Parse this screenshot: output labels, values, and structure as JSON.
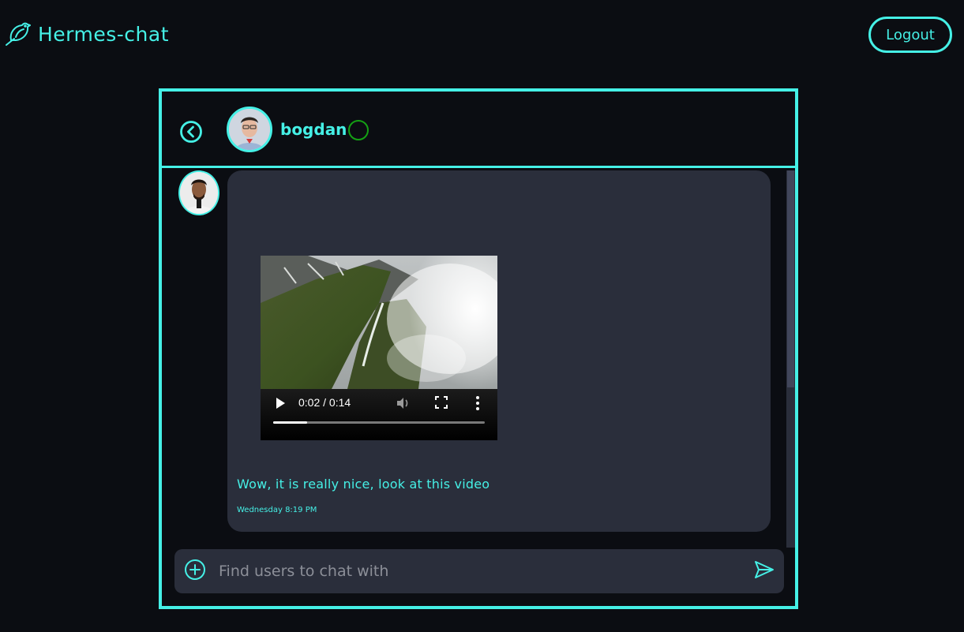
{
  "app": {
    "title": "Hermes-chat",
    "logout_label": "Logout",
    "logo_icon": "bird-icon"
  },
  "colors": {
    "accent": "#45f0e6",
    "background": "#0b0d12",
    "surface": "#2a2e3b",
    "online_status": "#14a014"
  },
  "chat": {
    "peer": {
      "name": "bogdan",
      "status": "online"
    },
    "messages": [
      {
        "media": {
          "type": "video",
          "time_display": "0:02 / 0:14",
          "progress": 0.16
        },
        "text": "Wow, it is really nice, look at this video",
        "timestamp": "Wednesday 8:19 PM"
      }
    ]
  },
  "composer": {
    "placeholder": "Find users to chat with",
    "value": ""
  }
}
